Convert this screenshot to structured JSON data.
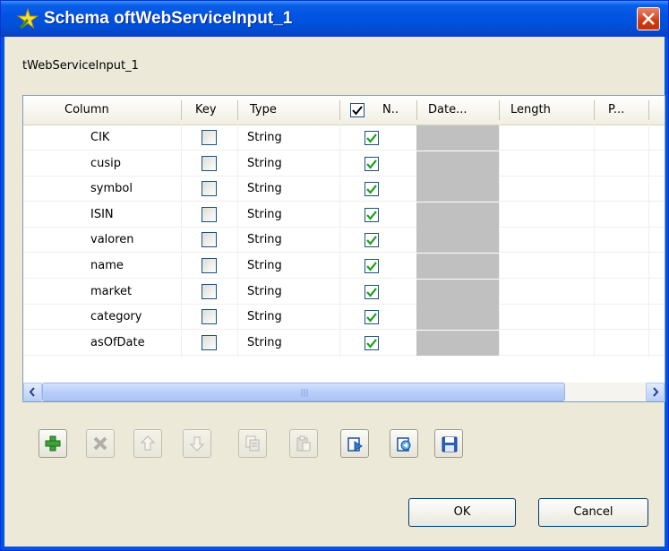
{
  "window": {
    "title": "Schema oftWebServiceInput_1"
  },
  "schema_name": "tWebServiceInput_1",
  "table": {
    "columns": [
      "Column",
      "Key",
      "Type",
      "N..",
      "Date...",
      "Length",
      "P..."
    ],
    "rows": [
      {
        "column": "CIK",
        "key": false,
        "type": "String",
        "nullable": true
      },
      {
        "column": "cusip",
        "key": false,
        "type": "String",
        "nullable": true
      },
      {
        "column": "symbol",
        "key": false,
        "type": "String",
        "nullable": true
      },
      {
        "column": "ISIN",
        "key": false,
        "type": "String",
        "nullable": true
      },
      {
        "column": "valoren",
        "key": false,
        "type": "String",
        "nullable": true
      },
      {
        "column": "name",
        "key": false,
        "type": "String",
        "nullable": true
      },
      {
        "column": "market",
        "key": false,
        "type": "String",
        "nullable": true
      },
      {
        "column": "category",
        "key": false,
        "type": "String",
        "nullable": true
      },
      {
        "column": "asOfDate",
        "key": false,
        "type": "String",
        "nullable": true
      }
    ]
  },
  "toolbar": [
    {
      "icon": "add-icon",
      "enabled": true
    },
    {
      "icon": "delete-icon",
      "enabled": false
    },
    {
      "icon": "move-up-icon",
      "enabled": false
    },
    {
      "icon": "move-down-icon",
      "enabled": false
    },
    {
      "icon": "copy-icon",
      "enabled": false
    },
    {
      "icon": "paste-icon",
      "enabled": false
    },
    {
      "icon": "import-icon",
      "enabled": true
    },
    {
      "icon": "export-icon",
      "enabled": true
    },
    {
      "icon": "save-icon",
      "enabled": true
    }
  ],
  "buttons": {
    "ok": "OK",
    "cancel": "Cancel"
  },
  "colors": {
    "titlebar": "#0054e3",
    "check": "#21a121",
    "face": "#ece9d8",
    "disabled_cell": "#c0c0c0"
  }
}
